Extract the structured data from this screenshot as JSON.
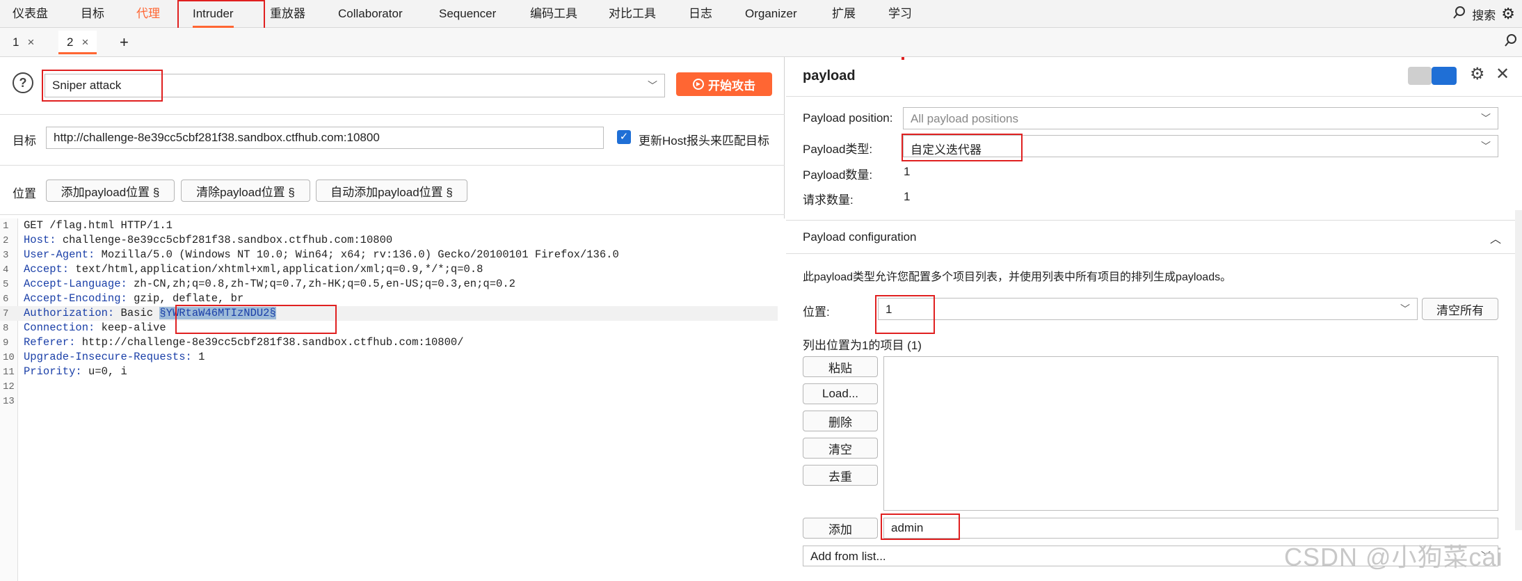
{
  "menubar": {
    "items": [
      "仪表盘",
      "目标",
      "代理",
      "Intruder",
      "重放器",
      "Collaborator",
      "Sequencer",
      "编码工具",
      "对比工具",
      "日志",
      "Organizer",
      "扩展",
      "学习"
    ],
    "search_label": "搜索"
  },
  "tabs": {
    "items": [
      {
        "label": "1",
        "close": "×"
      },
      {
        "label": "2",
        "close": "×"
      }
    ],
    "add": "+"
  },
  "attack": {
    "help": "?",
    "type_value": "Sniper attack",
    "start_label": "开始攻击"
  },
  "target": {
    "label": "目标",
    "url": "http://challenge-8e39cc5cbf281f38.sandbox.ctfhub.com:10800",
    "update_host_label": "更新Host报头来匹配目标"
  },
  "positions": {
    "label": "位置",
    "add_btn": "添加payload位置 §",
    "clear_btn": "清除payload位置 §",
    "auto_btn": "自动添加payload位置 §"
  },
  "request": {
    "lines": [
      {
        "num": "1",
        "key": "",
        "val": "GET /flag.html HTTP/1.1"
      },
      {
        "num": "2",
        "key": "Host:",
        "val": " challenge-8e39cc5cbf281f38.sandbox.ctfhub.com:10800"
      },
      {
        "num": "3",
        "key": "User-Agent:",
        "val": " Mozilla/5.0 (Windows NT 10.0; Win64; x64; rv:136.0) Gecko/20100101 Firefox/136.0"
      },
      {
        "num": "4",
        "key": "Accept:",
        "val": " text/html,application/xhtml+xml,application/xml;q=0.9,*/*;q=0.8"
      },
      {
        "num": "5",
        "key": "Accept-Language:",
        "val": " zh-CN,zh;q=0.8,zh-TW;q=0.7,zh-HK;q=0.5,en-US;q=0.3,en;q=0.2"
      },
      {
        "num": "6",
        "key": "Accept-Encoding:",
        "val": " gzip, deflate, br"
      },
      {
        "num": "7",
        "key": "Authorization:",
        "val": " Basic "
      },
      {
        "num": "8",
        "key": "Connection:",
        "val": " keep-alive"
      },
      {
        "num": "9",
        "key": "Referer:",
        "val": " http://challenge-8e39cc5cbf281f38.sandbox.ctfhub.com:10800/"
      },
      {
        "num": "10",
        "key": "Upgrade-Insecure-Requests:",
        "val": " 1"
      },
      {
        "num": "11",
        "key": "Priority:",
        "val": " u=0, i"
      },
      {
        "num": "12",
        "key": "",
        "val": ""
      },
      {
        "num": "13",
        "key": "",
        "val": ""
      }
    ],
    "payload_marker": "§YWRtaW46MTIzNDU2§"
  },
  "payload_panel": {
    "title": "payload",
    "position_label": "Payload position:",
    "position_value": "All payload positions",
    "type_label": "Payload类型:",
    "type_value": "自定义迭代器",
    "count_label": "Payload数量:",
    "count_value": "1",
    "requests_label": "请求数量:",
    "requests_value": "1",
    "config_title": "Payload configuration",
    "config_desc": "此payload类型允许您配置多个项目列表，并使用列表中所有项目的排列生成payloads。",
    "pos_label": "位置:",
    "pos_value": "1",
    "clear_all": "清空所有",
    "list_label": "列出位置为1的项目 (1)",
    "btn_paste": "粘贴",
    "btn_load": "Load...",
    "btn_delete": "删除",
    "btn_clear": "清空",
    "btn_dedupe": "去重",
    "btn_add": "添加",
    "add_value": "admin",
    "add_from_list": "Add from list..."
  },
  "watermark": "CSDN @小狗菜cai",
  "colors": {
    "accent": "#ff6633",
    "highlight_box": "#e02020",
    "checkbox": "#1f6fd6",
    "header_key": "#1a3fa8"
  }
}
